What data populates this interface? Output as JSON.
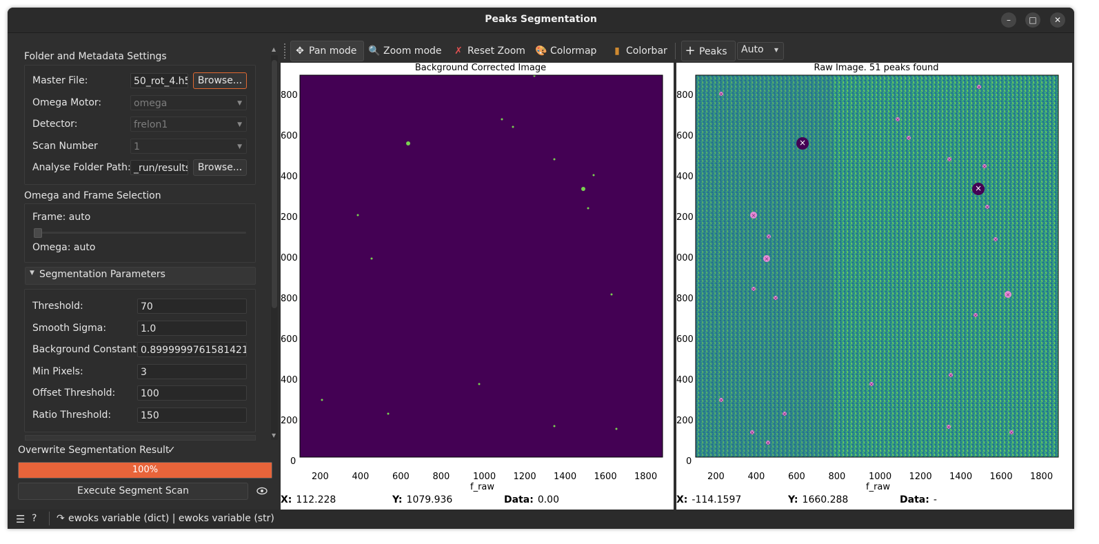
{
  "window": {
    "title": "Peaks Segmentation"
  },
  "folder": {
    "header": "Folder and Metadata Settings",
    "master_file_label": "Master File:",
    "master_file_value": "50_rot_4.h5",
    "browse_label": "Browse...",
    "omega_motor_label": "Omega Motor:",
    "omega_motor_value": "omega",
    "detector_label": "Detector:",
    "detector_value": "frelon1",
    "scan_number_label": "Scan Number",
    "scan_number_value": "1",
    "analyse_label": "Analyse Folder Path:",
    "analyse_value": "_run/results",
    "browse2_label": "Browse..."
  },
  "omega": {
    "header": "Omega and Frame Selection",
    "frame_label": "Frame: auto",
    "omega_label": "Omega: auto"
  },
  "segmentation": {
    "header": "Segmentation Parameters",
    "params": [
      {
        "label": "Threshold:",
        "value": "70"
      },
      {
        "label": "Smooth Sigma:",
        "value": "1.0"
      },
      {
        "label": "Background Constant:",
        "value": "0.8999999761581421"
      },
      {
        "label": "Min Pixels:",
        "value": "3"
      },
      {
        "label": "Offset Threshold:",
        "value": "100"
      },
      {
        "label": "Ratio Threshold:",
        "value": "150"
      }
    ]
  },
  "bottom": {
    "overwrite_label": "Overwrite Segmentation Result",
    "overwrite_check": "✓",
    "progress_text": "100%",
    "progress_value": 1.0,
    "execute_label": "Execute Segment Scan"
  },
  "toolbar": {
    "pan": "Pan mode",
    "zoom": "Zoom mode",
    "reset": "Reset Zoom",
    "colormap": "Colormap",
    "colorbar": "Colorbar",
    "peaks": "Peaks",
    "auto": "Auto"
  },
  "plots": {
    "left_title": "Background Corrected Image",
    "right_title": "Raw Image. 51 peaks found",
    "xlabel": "f_raw",
    "xticks": [
      "200",
      "400",
      "600",
      "800",
      "1000",
      "1200",
      "1400",
      "1600",
      "1800"
    ],
    "yticks": [
      "800",
      "600",
      "400",
      "200",
      "000",
      "800",
      "600",
      "400",
      "200",
      "0"
    ]
  },
  "status_left": {
    "x_label": "X:",
    "x_value": "112.228",
    "y_label": "Y:",
    "y_value": "1079.936",
    "data_label": "Data:",
    "data_value": "0.00"
  },
  "status_right": {
    "x_label": "X:",
    "x_value": "-114.1597",
    "y_label": "Y:",
    "y_value": "1660.288",
    "data_label": "Data:",
    "data_value": "-"
  },
  "footer": {
    "text": "ewoks variable (dict) | ewoks variable (str)"
  },
  "colors": {
    "accent": "#e8643a",
    "viridis_dark": "#440154",
    "viridis_mid": "#35a078"
  },
  "icons": [
    "minimize-icon",
    "maximize-icon",
    "close-icon",
    "pan-icon",
    "zoom-icon",
    "reset-zoom-icon",
    "colormap-icon",
    "colorbar-icon",
    "add-peaks-icon",
    "eye-icon",
    "menu-icon",
    "help-icon",
    "export-icon"
  ]
}
